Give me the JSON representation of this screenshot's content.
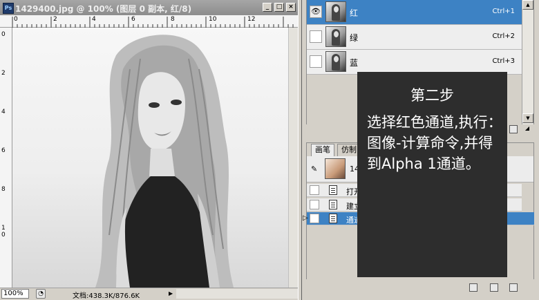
{
  "document": {
    "title": "1429400.jpg @ 100% (图层 0 副本, 红/8)",
    "app_icon": "Ps",
    "window_buttons": {
      "minimize": "_",
      "maximize": "□",
      "close": "×"
    },
    "ruler_top_marks": [
      "0",
      "2",
      "4",
      "6",
      "8",
      "10",
      "12"
    ],
    "ruler_left_marks": [
      "0",
      "2",
      "4",
      "6",
      "8",
      "1\n0"
    ],
    "zoom": "100%",
    "doc_size": "文档:438.3K/876.6K"
  },
  "channels": {
    "rows": [
      {
        "name": "红",
        "shortcut": "Ctrl+1",
        "visible": true,
        "selected": true
      },
      {
        "name": "绿",
        "shortcut": "Ctrl+2",
        "visible": false,
        "selected": false
      },
      {
        "name": "蓝",
        "shortcut": "Ctrl+3",
        "visible": false,
        "selected": false
      }
    ]
  },
  "history": {
    "tabs": [
      "画笔",
      "仿制"
    ],
    "snapshot_label": "14",
    "steps": [
      {
        "label": "打开",
        "selected": false
      },
      {
        "label": "建立",
        "selected": false
      },
      {
        "label": "通道",
        "selected": true
      }
    ]
  },
  "overlay": {
    "title": "第二步",
    "body": "选择红色通道,执行：图像-计算命令,并得到Alpha 1通道。"
  },
  "icons": {
    "eye": "eye-icon",
    "snapshot": "brush-icon",
    "new": "new-icon",
    "delete": "trash-icon"
  },
  "colors": {
    "selection": "#3d82c4",
    "overlay_bg": "#2d2d2d",
    "panel_bg": "#d4d0c8"
  }
}
